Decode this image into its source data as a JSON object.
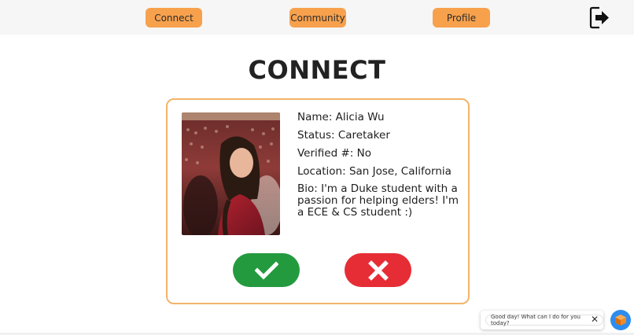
{
  "nav": {
    "connect_label": "Connect",
    "community_label": "Community",
    "profile_label": "Profile",
    "logout_icon": "logout-icon"
  },
  "page": {
    "title": "CONNECT"
  },
  "profile_card": {
    "name": "Name: Alicia Wu",
    "status": "Status: Caretaker",
    "verified": "Verified #: No",
    "location": "Location: San Jose, California",
    "bio": "Bio: I'm a Duke student with a passion for helping elders! I'm a ECE & CS student :)",
    "accept_icon": "checkmark-icon",
    "reject_icon": "close-icon"
  },
  "chat": {
    "greeting": "Good day! What can I do for you today?",
    "close_glyph": "✕",
    "launcher_icon": "chat-bot-icon"
  },
  "colors": {
    "nav_button": "#f7a14d",
    "card_border": "#f2b46b",
    "accept": "#249a3f",
    "reject": "#e62d35",
    "chat_launcher": "#2d8cf0"
  }
}
